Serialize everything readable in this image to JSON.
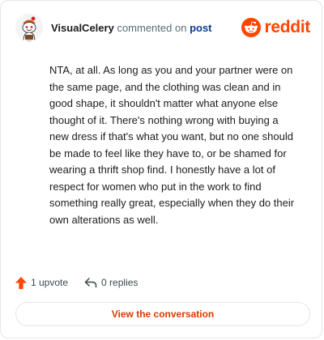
{
  "header": {
    "username": "VisualCelery",
    "action_text": "commented on",
    "post_link": "post",
    "brand": "reddit"
  },
  "comment": {
    "text": "NTA, at all. As long as you and your partner were on the same page, and the clothing was clean and in good shape, it shouldn't matter what anyone else thought of it. There's nothing wrong with buying a new dress if that's what you want, but no one should be made to feel like they have to, or be shamed for wearing a thrift shop find. I honestly have a lot of respect for women who put in the work to find something really great, especially when they do their own alterations as well."
  },
  "actions": {
    "upvote_label": "1 upvote",
    "replies_label": "0 replies"
  },
  "cta": {
    "label": "View the conversation"
  },
  "colors": {
    "brand": "#ff4500",
    "upvote": "#ff4500",
    "link": "#0a3d91",
    "cta_text": "#d93a00"
  },
  "icons": {
    "avatar": "snoo-avatar",
    "brand": "snoo-logo-icon",
    "upvote": "upvote-arrow-icon",
    "reply": "reply-arrow-icon"
  }
}
